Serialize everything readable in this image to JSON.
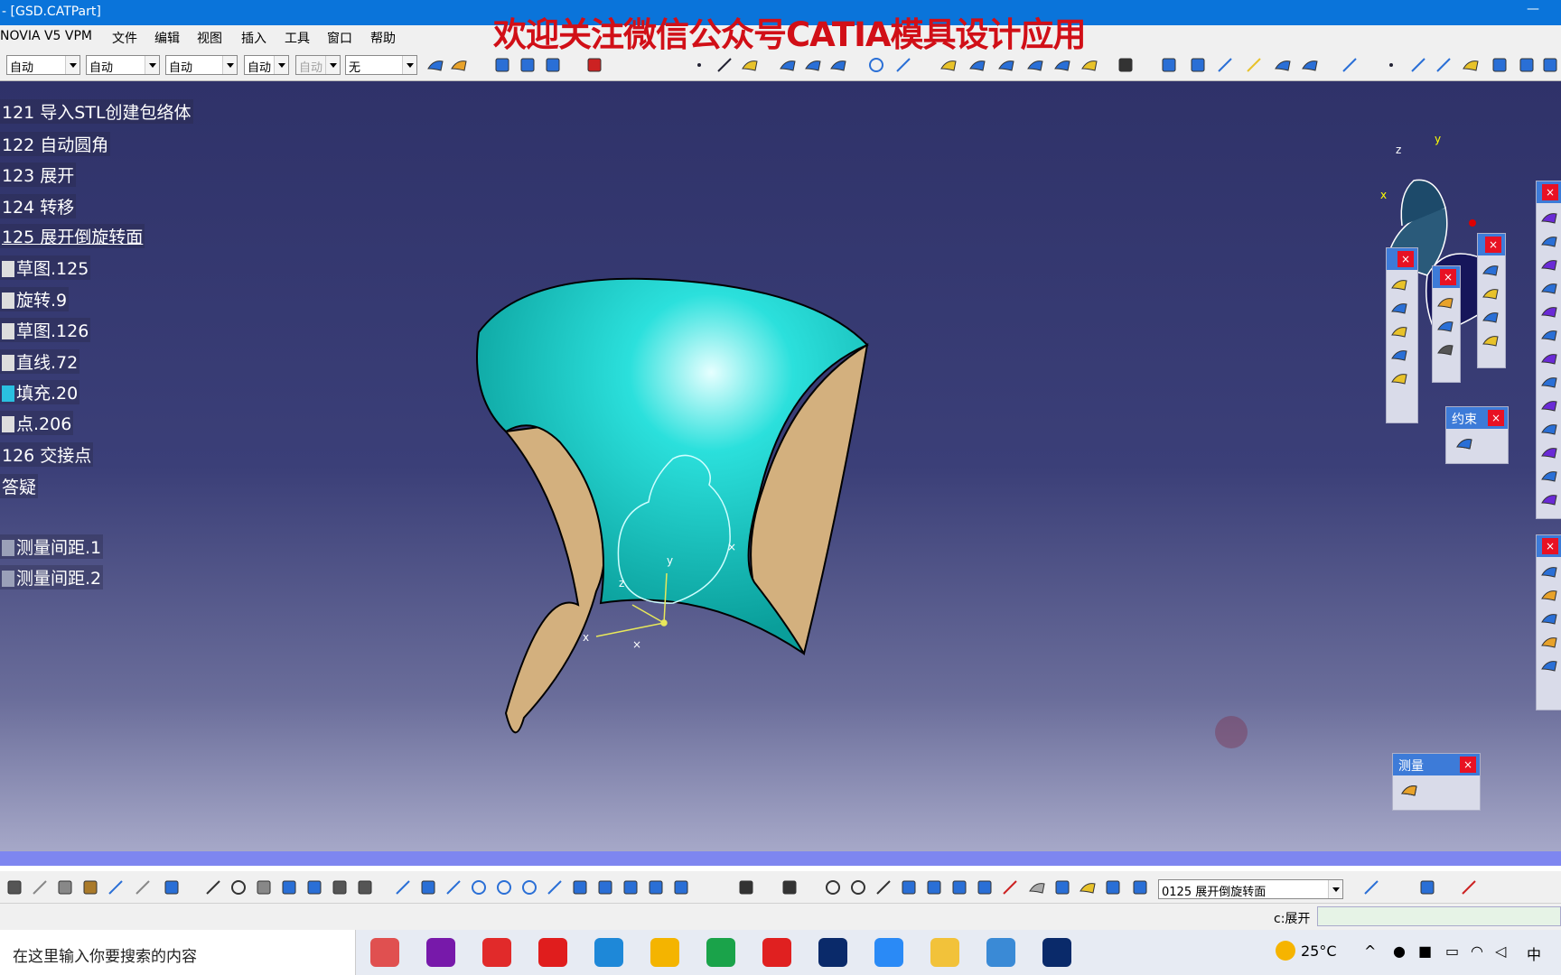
{
  "title": "- [GSD.CATPart]",
  "watermark": "欢迎关注微信公众号CATIA模具设计应用",
  "menu": [
    "NOVIA V5 VPM",
    "文件",
    "编辑",
    "视图",
    "插入",
    "工具",
    "窗口",
    "帮助"
  ],
  "combos": [
    {
      "value": "自动",
      "disabled": false
    },
    {
      "value": "自动",
      "disabled": false
    },
    {
      "value": "自动",
      "disabled": false
    },
    {
      "value": "自动",
      "disabled": false
    },
    {
      "value": "自动",
      "disabled": true
    },
    {
      "value": "无",
      "disabled": false
    }
  ],
  "tree": [
    {
      "label": "121 导入STL创建包络体"
    },
    {
      "label": "122 自动圆角"
    },
    {
      "label": "123 展开"
    },
    {
      "label": "124 转移"
    },
    {
      "label": "125 展开倒旋转面"
    },
    {
      "label": "草图.125"
    },
    {
      "label": "旋转.9"
    },
    {
      "label": "草图.126"
    },
    {
      "label": "直线.72"
    },
    {
      "label": "填充.20"
    },
    {
      "label": "点.206"
    },
    {
      "label": "126 交接点"
    },
    {
      "label": "答疑"
    },
    {
      "label": "测量间距.1"
    },
    {
      "label": "测量间距.2"
    }
  ],
  "panels": {
    "constraint": "约束",
    "measure": "测量",
    "close": "×"
  },
  "axis_labels": {
    "x": "x",
    "y": "y",
    "z": "z"
  },
  "bottom_combo": "0125 展开倒旋转面",
  "status_text": "c:展开",
  "taskbar": {
    "search_placeholder": "在这里输入你要搜索的内容",
    "temperature": "25°C",
    "ime": "中"
  },
  "colors": {
    "titlebar": "#0a74da",
    "watermark": "#d10f17",
    "surface_top": "#1fd6d2",
    "surface_back": "#d3b07e",
    "viewport_top": "#2f3269",
    "viewport_bottom": "#a6a8c8"
  }
}
